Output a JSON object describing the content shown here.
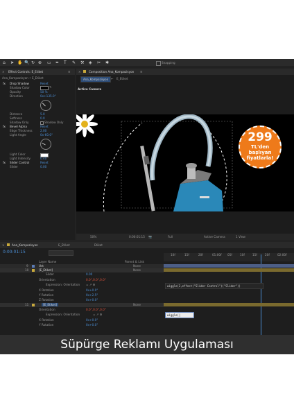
{
  "toolbar": {
    "snapping": "Snapping"
  },
  "effect_controls": {
    "tab": "Effect Controls: E_Etiket",
    "breadcrumb": "Ana_Kompozisyon • E_Etiket",
    "rows": [
      {
        "label": "Drop Shadow",
        "value": "Reset"
      },
      {
        "label": "Shadow Color",
        "value": ""
      },
      {
        "label": "Opacity",
        "value": "50 %"
      },
      {
        "label": "Direction",
        "value": "0x+135.0°"
      },
      {
        "label": "Distance",
        "value": "5.0"
      },
      {
        "label": "Softness",
        "value": "0.0"
      },
      {
        "label": "Shadow Only",
        "value": "Shadow Only"
      },
      {
        "label": "Bevel Alpha",
        "value": "Reset"
      },
      {
        "label": "Edge Thickness",
        "value": "2.00"
      },
      {
        "label": "Light Angle",
        "value": "0x-60.0°"
      },
      {
        "label": "Light Color",
        "value": ""
      },
      {
        "label": "Light Intensity",
        "value": "0.40"
      },
      {
        "label": "Slider Control",
        "value": "Reset"
      },
      {
        "label": "Slider",
        "value": "0.00"
      }
    ]
  },
  "composition": {
    "tab": "Composition Ana_Kompozisyon",
    "subtab_active": "Ana_Kompozisyon",
    "subtab_other": "E_Etiket",
    "camera": "Active Camera",
    "badge": {
      "price": "299",
      "line1": "TL'den",
      "line2": "başlıyan",
      "line3": "fiyatlarla!"
    },
    "footer": {
      "zoom": "50%",
      "timecode": "0:00:01:15",
      "resolution": "Full",
      "camera": "Active Camera",
      "view": "1 View"
    }
  },
  "timeline": {
    "tabs": [
      "Ana_Kompozisyon",
      "E_Etiket",
      "Etiket"
    ],
    "timecode": "0:00:01:15",
    "col_layer_name": "Layer Name",
    "col_parent": "Parent & Link",
    "ruler": [
      "10f",
      "15f",
      "20f",
      "01:00f",
      "05f",
      "10f",
      "15f",
      "20f",
      "02:00f",
      "05f",
      "10f",
      "15f",
      "20f",
      "03:00f",
      "05f"
    ],
    "layers": [
      {
        "num": "9",
        "name": "Ust",
        "parent": "None"
      },
      {
        "num": "10",
        "name": "[E_Etiket]",
        "parent": "None"
      },
      {
        "num": "",
        "name": "Slider",
        "value": "0.00"
      },
      {
        "num": "",
        "name": "Orientation",
        "value": "0.0°,0.0°,0.0°"
      },
      {
        "num": "",
        "name": "Expression: Orientation",
        "value": ""
      },
      {
        "num": "",
        "name": "X Rotation",
        "value": "0x+0.0°"
      },
      {
        "num": "",
        "name": "Y Rotation",
        "value": "0x+2.5°"
      },
      {
        "num": "",
        "name": "Z Rotation",
        "value": "0x+0.0°"
      },
      {
        "num": "11",
        "name": "[E_Etiket]",
        "parent": "None"
      },
      {
        "num": "",
        "name": "Orientation",
        "value": "0.0°,0.0°,0.0°"
      },
      {
        "num": "",
        "name": "Expression: Orientation",
        "value": ""
      },
      {
        "num": "",
        "name": "X Rotation",
        "value": "0x+0.0°"
      },
      {
        "num": "",
        "name": "Y Rotation",
        "value": "0x+0.0°"
      }
    ],
    "expression1": "wiggle(2,effect(\"Slider Control\")(\"Slider\"))",
    "expression2": "wiggle(|"
  },
  "caption": "Süpürge Reklamı Uygulaması"
}
